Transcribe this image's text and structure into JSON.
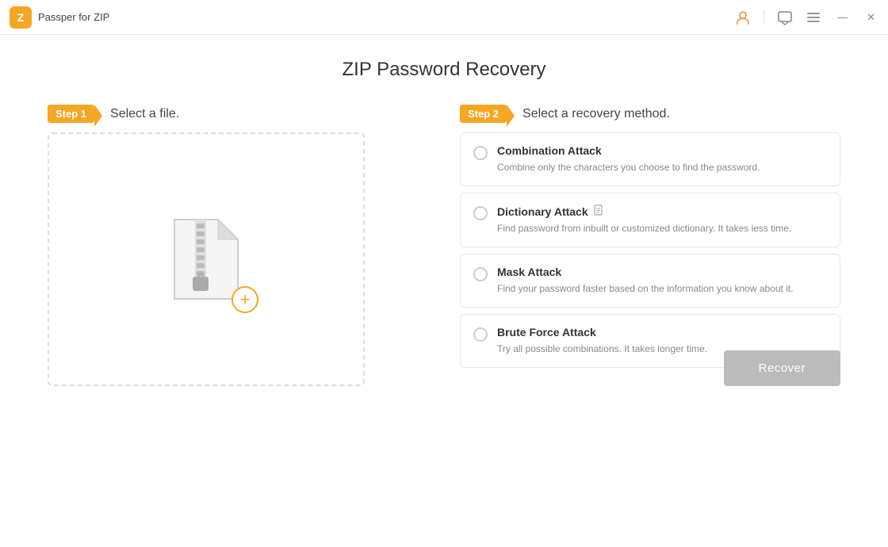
{
  "titleBar": {
    "appName": "Passper for ZIP",
    "icons": {
      "user": "👤",
      "chat": "💬",
      "menu": "☰",
      "minimize": "—",
      "close": "✕"
    }
  },
  "page": {
    "title": "ZIP Password Recovery"
  },
  "step1": {
    "badge": "Step 1",
    "label": "Select a file."
  },
  "step2": {
    "badge": "Step 2",
    "label": "Select a recovery method."
  },
  "methods": [
    {
      "id": "combination",
      "title": "Combination Attack",
      "desc": "Combine only the characters you choose to find the password.",
      "hasIcon": false
    },
    {
      "id": "dictionary",
      "title": "Dictionary Attack",
      "desc": "Find password from inbuilt or customized dictionary. It takes less time.",
      "hasIcon": true
    },
    {
      "id": "mask",
      "title": "Mask Attack",
      "desc": "Find your password faster based on the information you know about it.",
      "hasIcon": false
    },
    {
      "id": "bruteforce",
      "title": "Brute Force Attack",
      "desc": "Try all possible combinations. It takes longer time.",
      "hasIcon": false
    }
  ],
  "footer": {
    "recoverBtn": "Recover"
  }
}
